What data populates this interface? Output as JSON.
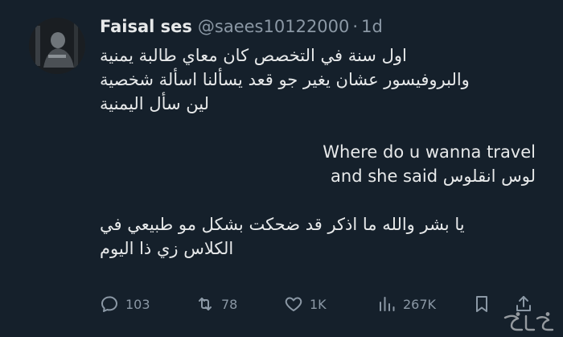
{
  "author": {
    "display_name": "Faisal ses",
    "handle": "@saees10122000",
    "separator": "·",
    "time": "1d"
  },
  "tweet": {
    "lines": [
      "اول سنة في التخصص كان معاي طالبة يمنية",
      "والبروفيسور عشان يغير جو قعد يسألنا اسألة شخصية",
      "لين سأل اليمنية",
      "Where do u wanna travel",
      "and she said لوس انقلوس",
      "يا بشر والله ما اذكر قد ضحكت بشكل مو طبيعي في",
      "الكلاس زي ذا اليوم"
    ]
  },
  "actions": {
    "replies": "103",
    "retweets": "78",
    "likes": "1K",
    "views": "267K"
  },
  "icons": {
    "reply": "reply-icon",
    "retweet": "retweet-icon",
    "like": "heart-icon",
    "views": "views-chart-icon",
    "bookmark": "bookmark-icon",
    "share": "share-icon"
  },
  "colors": {
    "background": "#15202b",
    "text": "#e7e9ea",
    "muted": "#8b98a5"
  }
}
